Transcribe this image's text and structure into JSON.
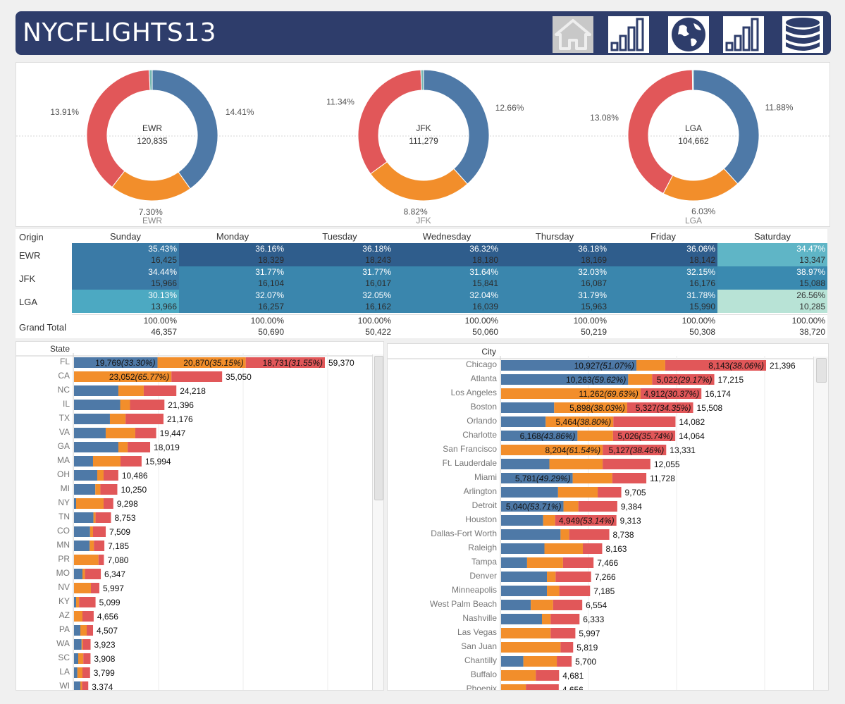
{
  "header": {
    "title": "NYCFLIGHTS13",
    "nav": [
      {
        "name": "home-icon",
        "disabled": true
      },
      {
        "name": "bar-chart-icon",
        "disabled": false
      },
      {
        "name": "globe-icon",
        "disabled": false
      },
      {
        "name": "bar-chart-icon-2",
        "disabled": false
      },
      {
        "name": "database-icon",
        "disabled": false
      }
    ]
  },
  "colors": {
    "blue": "#4e79a7",
    "orange": "#f28e2b",
    "red": "#e15759",
    "teal": "#76b7b2",
    "header": "#2e3d6b"
  },
  "chart_data": [
    {
      "type": "pie",
      "donuts": [
        {
          "origin": "EWR",
          "total": "120,835",
          "footer": "EWR",
          "slices": [
            {
              "label": "14.41%",
              "value": 14.41
            },
            {
              "label": "7.30%",
              "value": 7.3
            },
            {
              "label": "13.91%",
              "value": 13.91
            },
            {
              "label": "0.27%",
              "value": 0.27
            }
          ]
        },
        {
          "origin": "JFK",
          "total": "111,279",
          "footer": "JFK",
          "slices": [
            {
              "label": "12.66%",
              "value": 12.66
            },
            {
              "label": "8.82%",
              "value": 8.82
            },
            {
              "label": "11.34%",
              "value": 11.34
            },
            {
              "label": "0.22%",
              "value": 0.22
            }
          ]
        },
        {
          "origin": "LGA",
          "total": "104,662",
          "footer": "LGA",
          "slices": [
            {
              "label": "11.88%",
              "value": 11.88
            },
            {
              "label": "6.03%",
              "value": 6.03
            },
            {
              "label": "13.08%",
              "value": 13.08
            },
            {
              "label": "0.09%",
              "value": 0.09
            }
          ]
        }
      ]
    },
    {
      "type": "heatmap",
      "row_header": "Origin",
      "columns": [
        "Sunday",
        "Monday",
        "Tuesday",
        "Wednesday",
        "Thursday",
        "Friday",
        "Saturday"
      ],
      "rows": [
        {
          "label": "EWR",
          "pct": [
            "35.43%",
            "36.16%",
            "36.18%",
            "36.32%",
            "36.18%",
            "36.06%",
            "34.47%"
          ],
          "count": [
            "16,425",
            "18,329",
            "18,243",
            "18,180",
            "18,169",
            "18,142",
            "13,347"
          ],
          "level": [
            35.43,
            36.16,
            36.18,
            36.32,
            36.18,
            36.06,
            34.47
          ]
        },
        {
          "label": "JFK",
          "pct": [
            "34.44%",
            "31.77%",
            "31.77%",
            "31.64%",
            "32.03%",
            "32.15%",
            "38.97%"
          ],
          "count": [
            "15,966",
            "16,104",
            "16,017",
            "15,841",
            "16,087",
            "16,176",
            "15,088"
          ],
          "level": [
            34.44,
            31.77,
            31.77,
            31.64,
            32.03,
            32.15,
            38.97
          ]
        },
        {
          "label": "LGA",
          "pct": [
            "30.13%",
            "32.07%",
            "32.05%",
            "32.04%",
            "31.79%",
            "31.78%",
            "26.56%"
          ],
          "count": [
            "13,966",
            "16,257",
            "16,162",
            "16,039",
            "15,963",
            "15,990",
            "10,285"
          ],
          "level": [
            30.13,
            32.07,
            32.05,
            32.04,
            31.79,
            31.78,
            26.56
          ]
        }
      ],
      "grand_total": {
        "label": "Grand Total",
        "pct": [
          "100.00%",
          "100.00%",
          "100.00%",
          "100.00%",
          "100.00%",
          "100.00%",
          "100.00%"
        ],
        "count": [
          "46,357",
          "50,690",
          "50,422",
          "50,060",
          "50,219",
          "50,308",
          "38,720"
        ]
      }
    },
    {
      "type": "bar",
      "stacked": true,
      "header": "State",
      "max": 59370,
      "rows": [
        {
          "label": "FL",
          "total": "59,370",
          "segs": [
            {
              "v": 19769,
              "t": "19,769",
              "p": "(33.30%)"
            },
            {
              "v": 20870,
              "t": "20,870",
              "p": "(35.15%)"
            },
            {
              "v": 18731,
              "t": "18,731",
              "p": "(31.55%)"
            }
          ]
        },
        {
          "label": "CA",
          "total": "35,050",
          "segs": [
            {
              "v": 0
            },
            {
              "v": 23052,
              "t": "23,052",
              "p": "(65.77%)"
            },
            {
              "v": 11998
            }
          ]
        },
        {
          "label": "NC",
          "total": "24,218",
          "segs": [
            {
              "v": 10500
            },
            {
              "v": 6000
            },
            {
              "v": 7718
            }
          ]
        },
        {
          "label": "IL",
          "total": "21,396",
          "segs": [
            {
              "v": 10927
            },
            {
              "v": 2326
            },
            {
              "v": 8143
            }
          ]
        },
        {
          "label": "TX",
          "total": "21,176",
          "segs": [
            {
              "v": 8500
            },
            {
              "v": 3700
            },
            {
              "v": 8976
            }
          ]
        },
        {
          "label": "VA",
          "total": "19,447",
          "segs": [
            {
              "v": 7500
            },
            {
              "v": 7000
            },
            {
              "v": 4947
            }
          ]
        },
        {
          "label": "GA",
          "total": "18,019",
          "segs": [
            {
              "v": 10500
            },
            {
              "v": 2200
            },
            {
              "v": 5319
            }
          ]
        },
        {
          "label": "MA",
          "total": "15,994",
          "segs": [
            {
              "v": 4500
            },
            {
              "v": 6500
            },
            {
              "v": 4994
            }
          ]
        },
        {
          "label": "OH",
          "total": "10,486",
          "segs": [
            {
              "v": 5500
            },
            {
              "v": 1500
            },
            {
              "v": 3486
            }
          ]
        },
        {
          "label": "MI",
          "total": "10,250",
          "segs": [
            {
              "v": 5040
            },
            {
              "v": 1200
            },
            {
              "v": 4010
            }
          ]
        },
        {
          "label": "NY",
          "total": "9,298",
          "segs": [
            {
              "v": 500
            },
            {
              "v": 6500
            },
            {
              "v": 2298
            }
          ]
        },
        {
          "label": "TN",
          "total": "8,753",
          "segs": [
            {
              "v": 4600
            },
            {
              "v": 500
            },
            {
              "v": 3653
            }
          ]
        },
        {
          "label": "CO",
          "total": "7,509",
          "segs": [
            {
              "v": 3800
            },
            {
              "v": 700
            },
            {
              "v": 3009
            }
          ]
        },
        {
          "label": "MN",
          "total": "7,185",
          "segs": [
            {
              "v": 3700
            },
            {
              "v": 1000
            },
            {
              "v": 2485
            }
          ]
        },
        {
          "label": "PR",
          "total": "7,080",
          "segs": [
            {
              "v": 0
            },
            {
              "v": 5800
            },
            {
              "v": 1280
            }
          ]
        },
        {
          "label": "MO",
          "total": "6,347",
          "segs": [
            {
              "v": 2000
            },
            {
              "v": 600
            },
            {
              "v": 3747
            }
          ]
        },
        {
          "label": "NV",
          "total": "5,997",
          "segs": [
            {
              "v": 0
            },
            {
              "v": 4000
            },
            {
              "v": 1997
            }
          ]
        },
        {
          "label": "KY",
          "total": "5,099",
          "segs": [
            {
              "v": 500
            },
            {
              "v": 700
            },
            {
              "v": 3899
            }
          ]
        },
        {
          "label": "AZ",
          "total": "4,656",
          "segs": [
            {
              "v": 0
            },
            {
              "v": 2000
            },
            {
              "v": 2656
            }
          ]
        },
        {
          "label": "PA",
          "total": "4,507",
          "segs": [
            {
              "v": 1500
            },
            {
              "v": 1500
            },
            {
              "v": 1507
            }
          ]
        },
        {
          "label": "WA",
          "total": "3,923",
          "segs": [
            {
              "v": 1800
            },
            {
              "v": 300
            },
            {
              "v": 1823
            }
          ]
        },
        {
          "label": "SC",
          "total": "3,908",
          "segs": [
            {
              "v": 1000
            },
            {
              "v": 1200
            },
            {
              "v": 1708
            }
          ]
        },
        {
          "label": "LA",
          "total": "3,799",
          "segs": [
            {
              "v": 800
            },
            {
              "v": 1200
            },
            {
              "v": 1799
            }
          ]
        },
        {
          "label": "WI",
          "total": "3,374",
          "segs": [
            {
              "v": 1500
            },
            {
              "v": 400
            },
            {
              "v": 1474
            }
          ]
        }
      ]
    },
    {
      "type": "bar",
      "stacked": true,
      "header": "City",
      "max": 21396,
      "rows": [
        {
          "label": "Chicago",
          "total": "21,396",
          "segs": [
            {
              "v": 10927,
              "t": "10,927",
              "p": "(51.07%)"
            },
            {
              "v": 2326
            },
            {
              "v": 8143,
              "t": "8,143",
              "p": "(38.06%)"
            }
          ]
        },
        {
          "label": "Atlanta",
          "total": "17,215",
          "segs": [
            {
              "v": 10263,
              "t": "10,263",
              "p": "(59.62%)"
            },
            {
              "v": 1930
            },
            {
              "v": 5022,
              "t": "5,022",
              "p": "(29.17%)"
            }
          ]
        },
        {
          "label": "Los Angeles",
          "total": "16,174",
          "segs": [
            {
              "v": 0
            },
            {
              "v": 11262,
              "t": "11,262",
              "p": "(69.63%)"
            },
            {
              "v": 4912,
              "t": "4,912",
              "p": "(30.37%)"
            }
          ]
        },
        {
          "label": "Boston",
          "total": "15,508",
          "segs": [
            {
              "v": 4283
            },
            {
              "v": 5898,
              "t": "5,898",
              "p": "(38.03%)"
            },
            {
              "v": 5327,
              "t": "5,327",
              "p": "(34.35%)"
            }
          ]
        },
        {
          "label": "Orlando",
          "total": "14,082",
          "segs": [
            {
              "v": 3600
            },
            {
              "v": 5464,
              "t": "5,464",
              "p": "(38.80%)"
            },
            {
              "v": 5018
            }
          ]
        },
        {
          "label": "Charlotte",
          "total": "14,064",
          "segs": [
            {
              "v": 6168,
              "t": "6,168",
              "p": "(43.86%)"
            },
            {
              "v": 2870
            },
            {
              "v": 5026,
              "t": "5,026",
              "p": "(35.74%)"
            }
          ]
        },
        {
          "label": "San Francisco",
          "total": "13,331",
          "segs": [
            {
              "v": 0
            },
            {
              "v": 8204,
              "t": "8,204",
              "p": "(61.54%)"
            },
            {
              "v": 5127,
              "t": "5,127",
              "p": "(38.46%)"
            }
          ]
        },
        {
          "label": "Ft. Lauderdale",
          "total": "12,055",
          "segs": [
            {
              "v": 3900
            },
            {
              "v": 4300
            },
            {
              "v": 3855
            }
          ]
        },
        {
          "label": "Miami",
          "total": "11,728",
          "segs": [
            {
              "v": 5781,
              "t": "5,781",
              "p": "(49.29%)"
            },
            {
              "v": 3200
            },
            {
              "v": 2747
            }
          ]
        },
        {
          "label": "Arlington",
          "total": "9,705",
          "segs": [
            {
              "v": 4600
            },
            {
              "v": 3200
            },
            {
              "v": 1905
            }
          ]
        },
        {
          "label": "Detroit",
          "total": "9,384",
          "segs": [
            {
              "v": 5040,
              "t": "5,040",
              "p": "(53.71%)"
            },
            {
              "v": 1200
            },
            {
              "v": 3144
            }
          ]
        },
        {
          "label": "Houston",
          "total": "9,313",
          "segs": [
            {
              "v": 3400
            },
            {
              "v": 964
            },
            {
              "v": 4949,
              "t": "4,949",
              "p": "(53.14%)"
            }
          ]
        },
        {
          "label": "Dallas-Fort Worth",
          "total": "8,738",
          "segs": [
            {
              "v": 4800
            },
            {
              "v": 700
            },
            {
              "v": 3238
            }
          ]
        },
        {
          "label": "Raleigh",
          "total": "8,163",
          "segs": [
            {
              "v": 3500
            },
            {
              "v": 3100
            },
            {
              "v": 1563
            }
          ]
        },
        {
          "label": "Tampa",
          "total": "7,466",
          "segs": [
            {
              "v": 2100
            },
            {
              "v": 2900
            },
            {
              "v": 2466
            }
          ]
        },
        {
          "label": "Denver",
          "total": "7,266",
          "segs": [
            {
              "v": 3700
            },
            {
              "v": 700
            },
            {
              "v": 2866
            }
          ]
        },
        {
          "label": "Minneapolis",
          "total": "7,185",
          "segs": [
            {
              "v": 3700
            },
            {
              "v": 1000
            },
            {
              "v": 2485
            }
          ]
        },
        {
          "label": "West Palm Beach",
          "total": "6,554",
          "segs": [
            {
              "v": 2400
            },
            {
              "v": 1800
            },
            {
              "v": 2354
            }
          ]
        },
        {
          "label": "Nashville",
          "total": "6,333",
          "segs": [
            {
              "v": 3300
            },
            {
              "v": 700
            },
            {
              "v": 2333
            }
          ]
        },
        {
          "label": "Las Vegas",
          "total": "5,997",
          "segs": [
            {
              "v": 0
            },
            {
              "v": 4000
            },
            {
              "v": 1997
            }
          ]
        },
        {
          "label": "San Juan",
          "total": "5,819",
          "segs": [
            {
              "v": 0
            },
            {
              "v": 4800
            },
            {
              "v": 1019
            }
          ]
        },
        {
          "label": "Chantilly",
          "total": "5,700",
          "segs": [
            {
              "v": 1800
            },
            {
              "v": 2700
            },
            {
              "v": 1200
            }
          ]
        },
        {
          "label": "Buffalo",
          "total": "4,681",
          "segs": [
            {
              "v": 0
            },
            {
              "v": 2800
            },
            {
              "v": 1881
            }
          ]
        },
        {
          "label": "Phoenix",
          "total": "4,656",
          "segs": [
            {
              "v": 0
            },
            {
              "v": 2000
            },
            {
              "v": 2656
            }
          ]
        }
      ]
    }
  ]
}
